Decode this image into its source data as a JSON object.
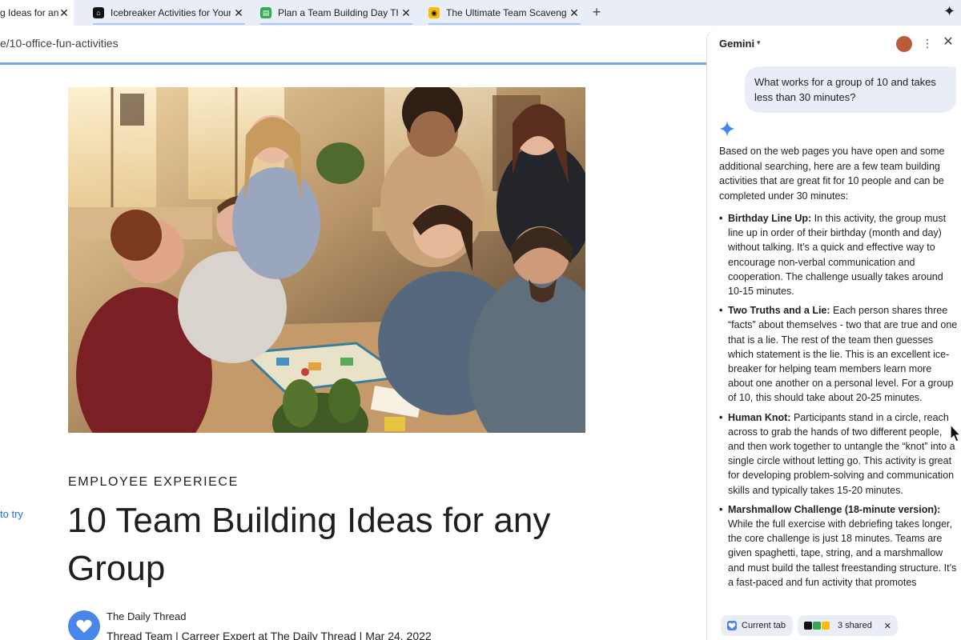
{
  "tabs": [
    {
      "title": "g Ideas for an",
      "favicon_color": "#1a73e8",
      "close": "✕"
    },
    {
      "title": "Icebreaker Activities for Your",
      "favicon_color": "#111111",
      "close": "✕"
    },
    {
      "title": "Plan a Team Building Day The",
      "favicon_color": "#34a853",
      "close": "✕"
    },
    {
      "title": "The Ultimate Team Scavenge",
      "favicon_color": "#fbbc04",
      "close": "✕"
    }
  ],
  "new_tab_glyph": "+",
  "gemini_toolbar_icon": "✦",
  "address_bar": {
    "url": "e/10-office-fun-activities"
  },
  "article": {
    "side_link": "to try",
    "kicker": "EMPLOYEE EXPERIECE",
    "headline": "10 Team Building Ideas for any Group",
    "author_name": "The Daily Thread",
    "author_meta": "Thread Team | Carreer Expert at The Daily Thread | Mar 24, 2022",
    "hero_icon": "team-photo"
  },
  "panel": {
    "title": "Gemini",
    "caret": "▾",
    "more_glyph": "⋮",
    "close_glyph": "✕",
    "user_prompt": "What works for a group of 10 and takes less than 30 minutes?",
    "answer_intro": "Based on the web pages you have open and some additional searching, here are a few team building activities that are great fit for 10 people and can be completed under 30 minutes:",
    "items": [
      {
        "title": "Birthday Line Up:",
        "text": " In this activity, the group must line up in order of their birthday (month and day) without talking. It’s a quick and effective way to encourage non-verbal communication and cooperation. The challenge usually takes around 10-15 minutes."
      },
      {
        "title": "Two Truths and a Lie:",
        "text": " Each person shares three “facts” about themselves - two that are true and one that is a lie. The rest of the team then guesses which statement is the lie. This is an excellent ice-breaker for helping team members learn more about one another on a personal level. For a group of 10, this should take about 20-25 minutes."
      },
      {
        "title": "Human Knot:",
        "text": " Participants stand in a circle, reach across to grab the hands of two different people, and then work together to untangle the “knot” into a single circle without letting go. This activity is great for developing problem-solving and communication skills and typically takes 15-20 minutes."
      },
      {
        "title": "Marshmallow Challenge (18-minute version):",
        "text": " While the full exercise with debriefing takes longer, the core challenge is just 18 minutes. Teams are given spaghetti, tape, string, and a marshmallow and must build the tallest freestanding structure. It’s a fast-paced and fun activity that promotes"
      }
    ],
    "footer": {
      "current_tab_label": "Current tab",
      "shared_label": "3 shared",
      "shared_close": "✕"
    },
    "accent_color": "#4285f4"
  }
}
